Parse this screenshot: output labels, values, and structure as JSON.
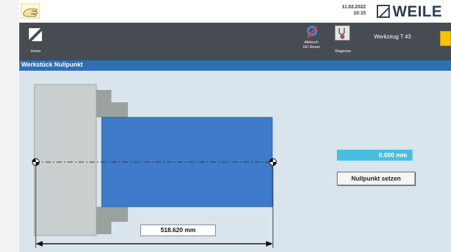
{
  "header": {
    "date": "11.02.2022",
    "time": "10:15",
    "brand": "WEILE"
  },
  "toolbar": {
    "home_label": "Home",
    "abort_label_1": "Abbruch",
    "abort_label_2": "NC-Reset",
    "diag_label": "Diagnose",
    "tool_label": "Werkzeug  T 43"
  },
  "panel": {
    "title": "Werkstück Nullpunkt",
    "offset_value": "0.000",
    "offset_unit": "mm",
    "set_zero_label": "Nullpunkt setzen",
    "length_value": "518.620",
    "length_unit": "mm"
  },
  "colors": {
    "title_bar": "#2f6fb4",
    "toolbar": "#474c52",
    "workpiece": "#3f7acb",
    "value_field": "#48bfe0"
  }
}
